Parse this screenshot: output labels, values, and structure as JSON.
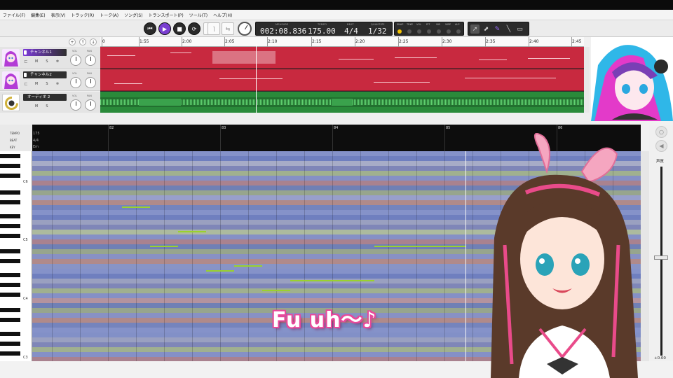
{
  "menu": [
    "ファイル(F)",
    "編集(E)",
    "表示(V)",
    "トラック(R)",
    "トーク(A)",
    "ソング(S)",
    "トランスポート(P)",
    "ツール(T)",
    "ヘルプ(H)"
  ],
  "lcd": {
    "measure_label": "MEASURE",
    "measure": "002:08.836",
    "tempo_label": "TEMPO",
    "tempo": "175.00",
    "beat_label": "BEAT",
    "beat": "4/4",
    "quantize_label": "QUANTIZE",
    "quantize": "1/32"
  },
  "mixer_labels": [
    "SNAP",
    "TRKE",
    "VOL",
    "PIT",
    "VIB",
    "VIBP",
    "ALP"
  ],
  "colors": {
    "accent": "#7c3bd9",
    "region_red": "#c8293f",
    "region_green": "#2a8a3a",
    "note": "#9ad22c",
    "caption_outline": "#e8499b"
  },
  "tracks": [
    {
      "name": "チャンネル1",
      "vol_label": "VOL",
      "pan_label": "PAN",
      "btn_l": "匚",
      "btn_m": "M",
      "btn_s": "S",
      "btn_x": "❄"
    },
    {
      "name": "チャンネル2",
      "vol_label": "VOL",
      "pan_label": "PAN",
      "btn_l": "匚",
      "btn_m": "M",
      "btn_s": "S",
      "btn_x": "❄"
    },
    {
      "name": "オーディオ 2",
      "vol_label": "VOL",
      "pan_label": "PAN",
      "btn_m": "M",
      "btn_s": "S"
    }
  ],
  "timeline": [
    "0",
    "1:55",
    "2:00",
    "2:05",
    "2:10",
    "2:15",
    "2:20",
    "2:25",
    "2:30",
    "2:35",
    "2:40",
    "2:45"
  ],
  "pianoroll": {
    "label_tempo": "TEMPO",
    "label_beat": "BEAT",
    "label_key": "KEY",
    "tempo_value": "175",
    "beat_value": "4/4",
    "key_value": "Em",
    "bars": [
      "82",
      "83",
      "84",
      "85",
      "86"
    ],
    "octaves": [
      "C6",
      "C5",
      "C4",
      "C3"
    ]
  },
  "voice": {
    "label": "声質",
    "value": "+0.00"
  },
  "caption": "Fu uh〜♪"
}
